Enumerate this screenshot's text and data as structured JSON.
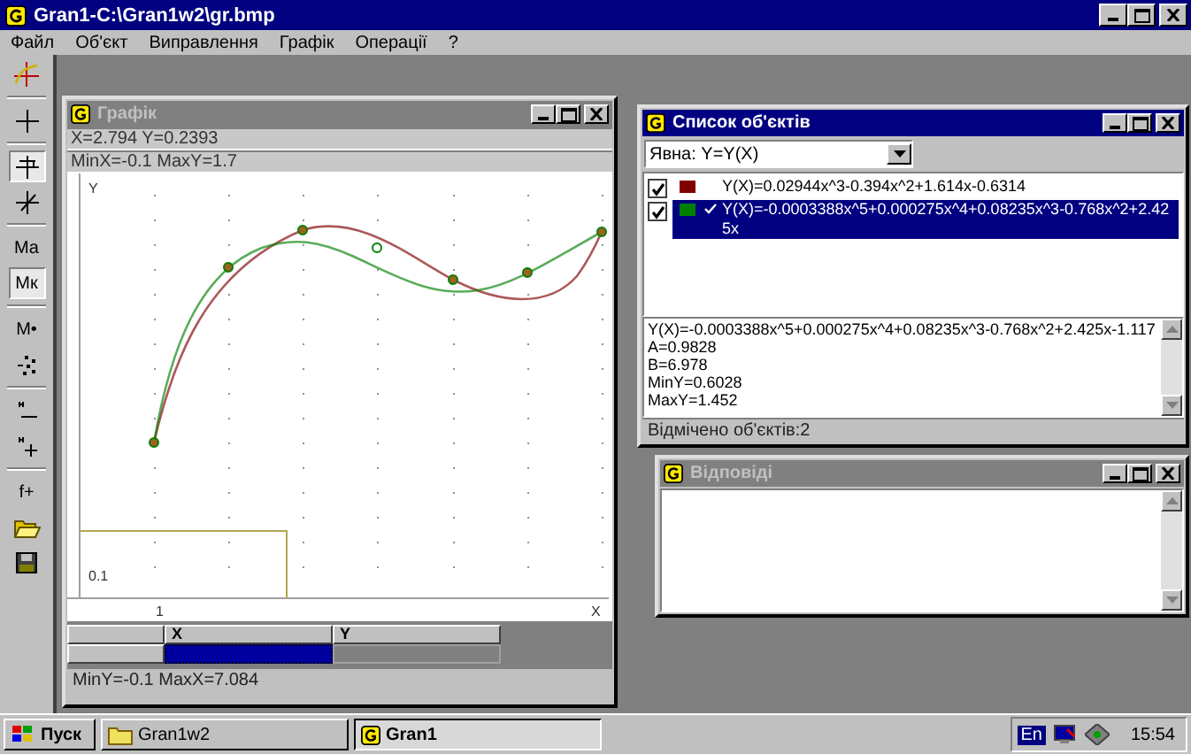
{
  "app": {
    "title": "Gran1-C:\\Gran1w2\\gr.bmp"
  },
  "menu": [
    "Файл",
    "Об'єкт",
    "Виправлення",
    "Графік",
    "Операції",
    "?"
  ],
  "toolbar": [
    {
      "kind": "plot",
      "pressed": false
    },
    {
      "kind": "separator"
    },
    {
      "kind": "cross",
      "pressed": false
    },
    {
      "kind": "separator"
    },
    {
      "kind": "cross-tick",
      "pressed": true
    },
    {
      "kind": "cross-slash",
      "pressed": false
    },
    {
      "kind": "separator"
    },
    {
      "kind": "text",
      "label": "Mа",
      "pressed": false
    },
    {
      "kind": "text",
      "label": "Mк",
      "pressed": true
    },
    {
      "kind": "separator"
    },
    {
      "kind": "text",
      "label": "M•",
      "pressed": false
    },
    {
      "kind": "scatter",
      "pressed": false
    },
    {
      "kind": "separator"
    },
    {
      "kind": "minus",
      "pressed": false
    },
    {
      "kind": "plus",
      "pressed": false
    },
    {
      "kind": "separator"
    },
    {
      "kind": "text",
      "label": "f+",
      "pressed": false
    },
    {
      "kind": "folder",
      "pressed": false
    },
    {
      "kind": "save",
      "pressed": false
    }
  ],
  "graph_window": {
    "title": "Графік",
    "active": false,
    "cursor": "X=2.794  Y=0.2393",
    "range_top": "MinX=-0.1  MaxY=1.7",
    "y_label": "Y",
    "x_label": "X",
    "y_tick": "0.1",
    "x_tick": "1",
    "table_columns": [
      "X",
      "Y"
    ],
    "status": "MinY=-0.1  MaxX=7.084"
  },
  "objects_window": {
    "title": "Список об'єктів",
    "active": true,
    "mode": "Явна: Y=Y(X)",
    "items": [
      {
        "checked": true,
        "color": "#800000",
        "selected": false,
        "text": "Y(X)=0.02944x^3-0.394x^2+1.614x-0.6314"
      },
      {
        "checked": true,
        "color": "#008000",
        "selected": true,
        "text": "Y(X)=-0.0003388x^5+0.000275x^4+0.08235x^3-0.768x^2+2.425x"
      }
    ],
    "details": [
      "Y(X)=-0.0003388x^5+0.000275x^4+0.08235x^3-0.768x^2+2.425x-1.117",
      "A=0.9828",
      "B=6.978",
      "MinY=0.6028",
      "MaxY=1.452"
    ],
    "status": "Відмічено об'єктів:2"
  },
  "answers_window": {
    "title": "Відповіді",
    "active": false
  },
  "taskbar": {
    "start": "Пуск",
    "tasks": [
      {
        "label": "Gran1w2",
        "kind": "folder",
        "selected": false
      },
      {
        "label": "Gran1",
        "kind": "app",
        "selected": true
      }
    ],
    "language": "En",
    "clock": "15:54"
  }
}
